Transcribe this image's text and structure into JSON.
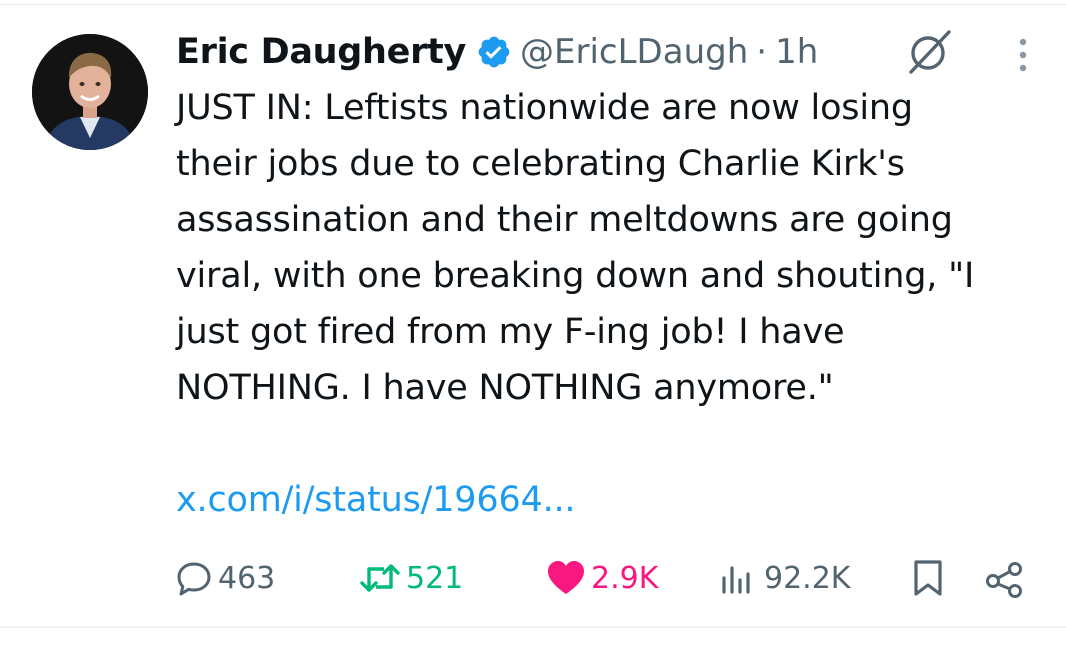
{
  "tweet": {
    "author_name": "Eric Daugherty",
    "handle": "@EricLDaugh",
    "separator": "·",
    "time": "1h",
    "text": "JUST IN: Leftists nationwide are now losing\ntheir jobs due to celebrating Charlie Kirk's\nassassination and their meltdowns are going\nviral, with one breaking down and shouting, \"I\njust got fired from my F-ing job! I have\nNOTHING. I have NOTHING anymore.\"",
    "link": "x.com/i/status/19664..."
  },
  "actions": {
    "replies": "463",
    "reposts": "521",
    "likes": "2.9K",
    "views": "92.2K"
  },
  "icons": {
    "verified": "verified-badge-icon",
    "grok": "grok-icon",
    "more": "more-options-icon",
    "reply": "reply-icon",
    "repost": "repost-icon",
    "like": "heart-icon",
    "views": "views-chart-icon",
    "bookmark": "bookmark-icon",
    "share": "share-icon"
  },
  "colors": {
    "text": "#0f1419",
    "muted": "#536471",
    "link": "#1d9bf0",
    "verified": "#1d9bf0",
    "repost": "#00ba7c",
    "like": "#f91880"
  }
}
